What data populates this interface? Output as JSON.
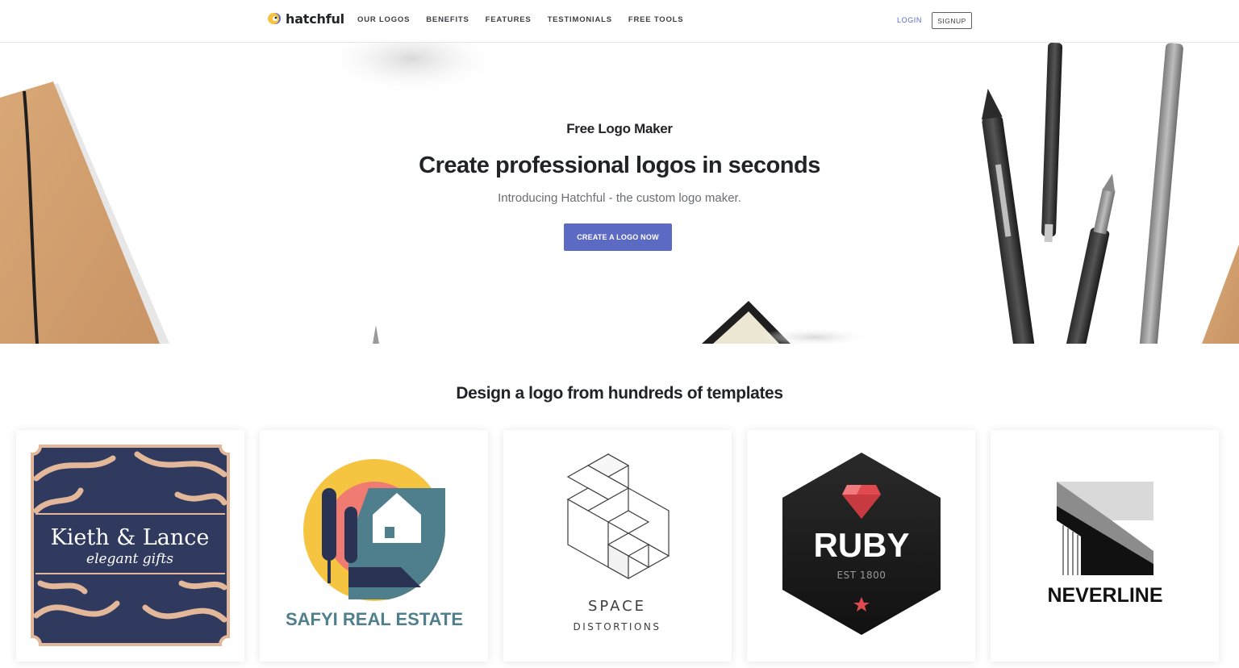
{
  "header": {
    "brand": "hatchful",
    "logo_icon": "hatchful-mark-icon",
    "nav": [
      "OUR LOGOS",
      "BENEFITS",
      "FEATURES",
      "TESTIMONIALS",
      "FREE TOOLS"
    ],
    "login": "LOGIN",
    "signup": "SIGNUP"
  },
  "hero": {
    "subtitle": "Free Logo Maker",
    "title": "Create professional logos in seconds",
    "description": "Introducing Hatchful - the custom logo maker.",
    "cta": "CREATE A LOGO NOW"
  },
  "templates": {
    "title": "Design a logo from hundreds of templates",
    "cards": [
      {
        "name": "Kieth & Lance",
        "tagline": "elegant gifts",
        "colors": {
          "bg": "#2f3a5e",
          "accent": "#e3b89a"
        }
      },
      {
        "name": "SAFYI REAL ESTATE",
        "colors": {
          "sun": "#f5c542",
          "roof": "#ef7b72",
          "house": "#4f7f8c",
          "text": "#4f7f8c"
        }
      },
      {
        "name": "SPACE",
        "tagline": "DISTORTIONS",
        "colors": {
          "text": "#3d3d3d"
        }
      },
      {
        "name": "RUBY",
        "tagline": "EST 1800",
        "colors": {
          "bg": "#1b1b1b",
          "gem": "#e04a4f"
        }
      },
      {
        "name": "NEVERLINE",
        "colors": {
          "text": "#111111"
        }
      }
    ]
  },
  "colors": {
    "accent": "#5c6ac4",
    "text": "#212326",
    "muted": "#6b6d72"
  }
}
